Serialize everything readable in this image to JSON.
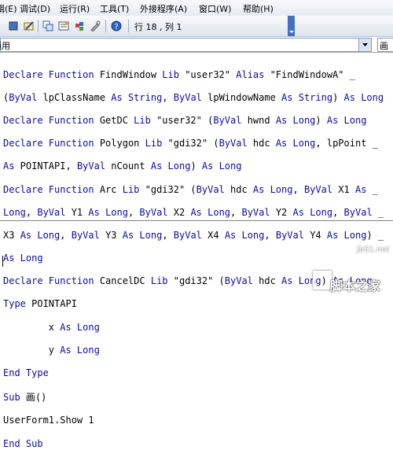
{
  "menu": [
    {
      "label": "编辑(E)",
      "name": "menu-edit"
    },
    {
      "label": "调试(D)",
      "name": "menu-debug"
    },
    {
      "label": "运行(R)",
      "name": "menu-run"
    },
    {
      "label": "工具(T)",
      "name": "menu-tools"
    },
    {
      "label": "外接程序(A)",
      "name": "menu-addins"
    },
    {
      "label": "窗口(W)",
      "name": "menu-window"
    },
    {
      "label": "帮助(H)",
      "name": "menu-help"
    }
  ],
  "toolbar": {
    "position": "行 18 , 列 1"
  },
  "combo": {
    "object": "通用",
    "procedure": "画"
  },
  "code": {
    "declarations": [
      "Declare Function FindWindow Lib \"user32\" Alias \"FindWindowA\" _",
      "(ByVal lpClassName As String, ByVal lpWindowName As String) As Long",
      "Declare Function GetDC Lib \"user32\" (ByVal hwnd As Long) As Long",
      "Declare Function Polygon Lib \"gdi32\" (ByVal hdc As Long, lpPoint _",
      "As POINTAPI, ByVal nCount As Long) As Long",
      "Declare Function Arc Lib \"gdi32\" (ByVal hdc As Long, ByVal X1 As _",
      "Long, ByVal Y1 As Long, ByVal X2 As Long, ByVal Y2 As Long, ByVal _",
      "X3 As Long, ByVal Y3 As Long, ByVal X4 As Long, ByVal Y4 As Long) _",
      "As Long",
      "Declare Function CancelDC Lib \"gdi32\" (ByVal hdc As Long) As Long",
      "Type POINTAPI",
      "        x As Long",
      "        y As Long",
      "End Type"
    ],
    "procedure": [
      "Sub 画()",
      "UserForm1.Show 1",
      "End Sub"
    ]
  },
  "watermark": {
    "site": "jb51.net",
    "brand": "脚本之家"
  }
}
